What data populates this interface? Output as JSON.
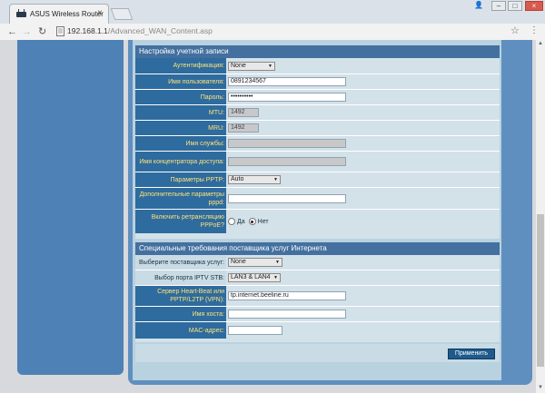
{
  "browser": {
    "tab_title": "ASUS Wireless Router",
    "url_host": "192.168.1.1",
    "url_path": "/Advanced_WAN_Content.asp"
  },
  "account": {
    "header": "Настройка учетной записи",
    "auth_label": "Аутентификация:",
    "auth_value": "None",
    "user_label": "Имя пользователя:",
    "user_value": "0891234567",
    "pass_label": "Пароль:",
    "pass_value": "••••••••••",
    "mtu_label": "MTU:",
    "mtu_value": "1492",
    "mru_label": "MRU:",
    "mru_value": "1492",
    "service_label": "Имя службы:",
    "service_value": "",
    "hub_label": "Имя концентратора доступа:",
    "hub_value": "",
    "pptp_label": "Параметры PPTP:",
    "pptp_value": "Auto",
    "pppd_label": "Дополнительные параметры pppd:",
    "pppd_value": "",
    "relay_label": "Включить ретрансляцию PPPoE?",
    "relay_yes": "Да",
    "relay_no": "Нет"
  },
  "isp": {
    "header": "Специальные требования поставщика услуг Интернета",
    "provider_label": "Выберите поставщика услуг:",
    "provider_value": "None",
    "iptv_label": "Выбор порта IPTV STB:",
    "iptv_value": "LAN3 & LAN4",
    "heartbeat_label": "Сервер Heart-Beat или PPTP/L2TP (VPN):",
    "heartbeat_value": "tp.internet.beeline.ru",
    "host_label": "Имя хоста:",
    "host_value": "",
    "mac_label": "MAC-адрес:",
    "mac_value": ""
  },
  "apply_label": "Применить"
}
